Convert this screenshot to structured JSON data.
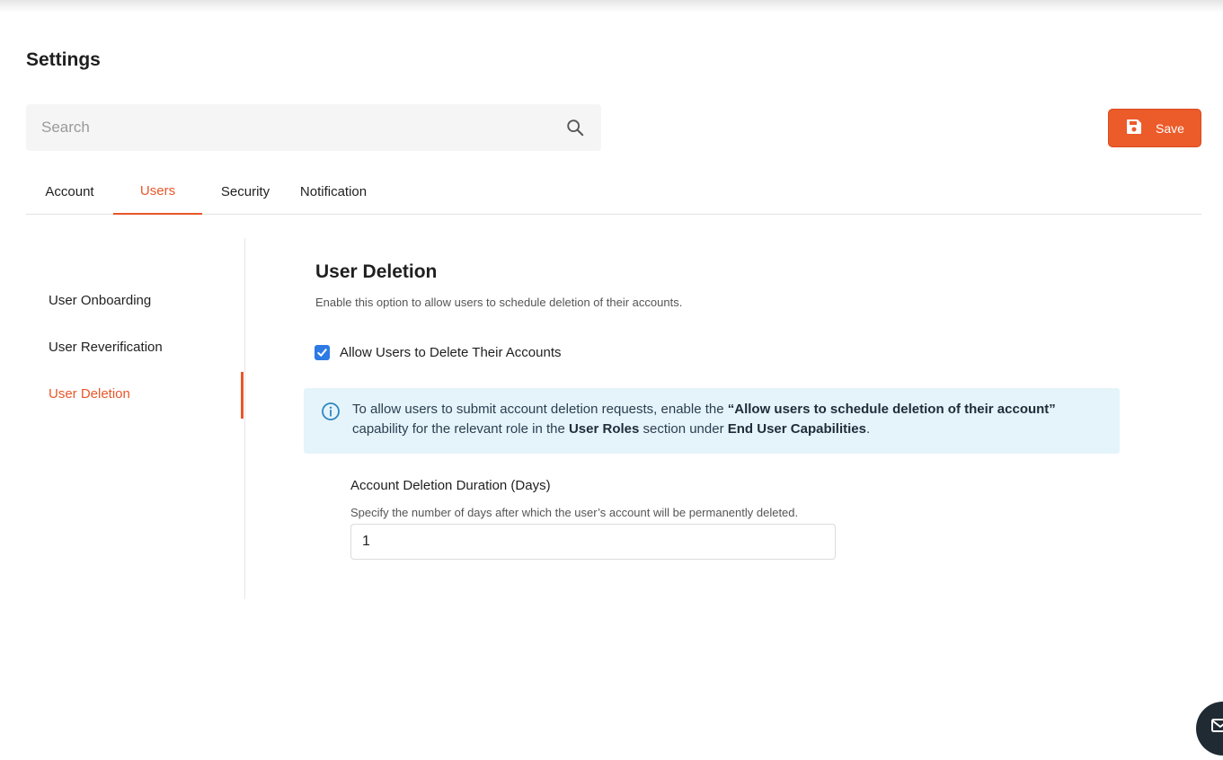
{
  "page": {
    "title": "Settings"
  },
  "search": {
    "placeholder": "Search"
  },
  "toolbar": {
    "save_label": "Save"
  },
  "tabs": [
    {
      "label": "Account",
      "active": false
    },
    {
      "label": "Users",
      "active": true
    },
    {
      "label": "Security",
      "active": false
    },
    {
      "label": "Notification",
      "active": false
    }
  ],
  "sidebar": {
    "items": [
      {
        "label": "User Onboarding",
        "active": false
      },
      {
        "label": "User Reverification",
        "active": false
      },
      {
        "label": "User Deletion",
        "active": true
      }
    ]
  },
  "section": {
    "title": "User Deletion",
    "description": "Enable this option to allow users to schedule deletion of their accounts.",
    "checkbox_label": "Allow Users to Delete Their Accounts",
    "checkbox_checked": true
  },
  "info": {
    "text_1": "To allow users to submit account deletion requests, enable the ",
    "bold_1": "“Allow users to schedule deletion of their account”",
    "text_2": " capability for the relevant role in the ",
    "bold_2": "User Roles",
    "text_3": " section under ",
    "bold_3": "End User Capabilities",
    "text_4": "."
  },
  "field": {
    "label": "Account Deletion Duration (Days)",
    "help": "Specify the number of days after which the user’s account will be permanently deleted.",
    "value": "1"
  },
  "colors": {
    "accent": "#e8572a",
    "save_button": "#ec5b2a",
    "checkbox": "#2d7ae5",
    "info_bg": "#e5f4fb"
  },
  "icons": {
    "search": "search-icon",
    "save": "save-icon",
    "info": "info-icon",
    "check": "check-icon",
    "chat": "chat-icon"
  }
}
